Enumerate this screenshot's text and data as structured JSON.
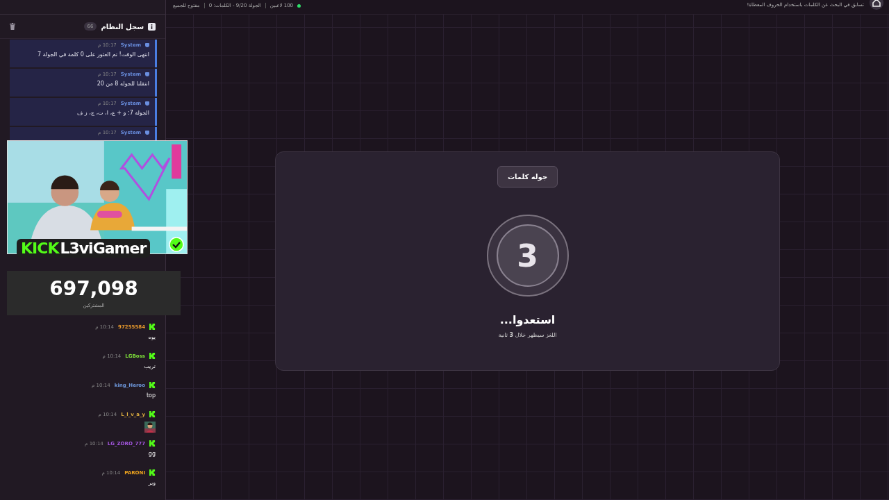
{
  "header": {
    "stats": [
      {
        "kind": "players",
        "text": "100 لاعبين"
      },
      {
        "kind": "round",
        "text": "الجولة 9/20 - الكلمات: 0"
      },
      {
        "kind": "access",
        "text": "مفتوح للجميع"
      }
    ],
    "description": "تسابق في البحث عن الكلمات باستخدام الحروف المعطاة!"
  },
  "system_log": {
    "title": "سجل النظام",
    "count": "66",
    "entries": [
      {
        "author": "System",
        "time": "10:17 م",
        "message": "انتهى الوقت! تم العثور على 0 كلمة في الجولة 7"
      },
      {
        "author": "System",
        "time": "10:17 م",
        "message": "انتقلنا للجوله 8 من 20"
      },
      {
        "author": "System",
        "time": "10:17 م",
        "message": "الجولة 7: و + ع، ا، ت، ج، ز ف"
      },
      {
        "author": "System",
        "time": "10:17 م"
      }
    ]
  },
  "chat": {
    "messages": [
      {
        "kind": "text",
        "user": "97255584",
        "color": "#e89a2c",
        "time": "10:14 م",
        "text": "يوه"
      },
      {
        "kind": "text",
        "user": "LGBoss",
        "color": "#7fe03a",
        "time": "10:14 م",
        "text": "تريب"
      },
      {
        "kind": "text",
        "user": "king_Heroo",
        "color": "#6e98dc",
        "time": "10:14 م",
        "text": "top"
      },
      {
        "kind": "emote",
        "user": "L_l_v_a_y",
        "color": "#e0b040",
        "time": "10:14 م"
      },
      {
        "kind": "text",
        "user": "LG_ZORO_777",
        "color": "#a456e0",
        "time": "10:14 م",
        "text": "gg"
      },
      {
        "kind": "text",
        "user": "PARONI",
        "color": "#f0a51e",
        "time": "10:14 م",
        "text": "وبر"
      }
    ]
  },
  "stream_overlay": {
    "logo": "KICK",
    "channel": "L3viGamer",
    "verified": true,
    "subscribers": "697,098",
    "subscribers_label": "المشتركين"
  },
  "stage": {
    "badge": "جوله كلمات",
    "countdown": "3",
    "title": "استعدوا...",
    "subtitle": "اللغز سيظهر خلال **3** ثانية"
  }
}
